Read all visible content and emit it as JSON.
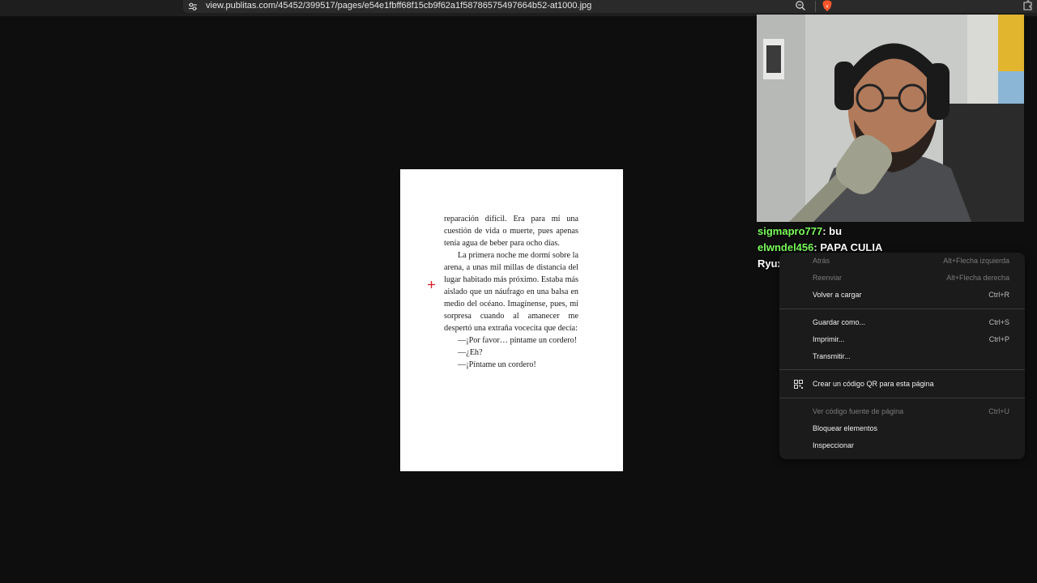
{
  "browser": {
    "url": "view.publitas.com/45452/399517/pages/e54e1fbff68f15cb9f62a1f58786575497664b52-at1000.jpg"
  },
  "page": {
    "paragraphs": [
      "reparación difícil. Era para mí una cuestión de vida o muerte, pues apenas tenía agua de beber para ocho días.",
      "La primera noche me dormí sobre la arena, a unas mil millas de distancia del lugar habitado más próximo. Estaba más aislado que un náufrago en una balsa en medio del océano. Imagínense, pues, mi sorpresa cuando al amanecer me despertó una extraña vocecita que decía:",
      "—¡Por favor… píntame un cordero!",
      "—¿Eh?",
      "—¡Píntame un cordero!"
    ]
  },
  "chat": [
    {
      "user": "sigmapro777",
      "message": "bu"
    },
    {
      "user": "elwndel456",
      "message": "PAPA CULIA"
    },
    {
      "user": "RyuxT",
      "message": ""
    }
  ],
  "context_menu": {
    "items": [
      {
        "label": "Atrás",
        "shortcut": "Alt+Flecha izquierda",
        "disabled": true
      },
      {
        "label": "Reenviar",
        "shortcut": "Alt+Flecha derecha",
        "disabled": true
      },
      {
        "label": "Volver a cargar",
        "shortcut": "Ctrl+R",
        "disabled": false
      },
      {
        "label": "Guardar como...",
        "shortcut": "Ctrl+S",
        "disabled": false
      },
      {
        "label": "Imprimir...",
        "shortcut": "Ctrl+P",
        "disabled": false
      },
      {
        "label": "Transmitir...",
        "shortcut": "",
        "disabled": false
      },
      {
        "label": "Crear un código QR para esta página",
        "shortcut": "",
        "disabled": false
      },
      {
        "label": "Ver código fuente de página",
        "shortcut": "Ctrl+U",
        "disabled": true
      },
      {
        "label": "Bloquear elementos",
        "shortcut": "",
        "disabled": false
      },
      {
        "label": "Inspeccionar",
        "shortcut": "",
        "disabled": false
      }
    ]
  },
  "colors": {
    "background": "#0e0e0e",
    "chat_username": "#7cff5c",
    "menu_bg": "#1b1b1b",
    "brave_orange": "#fb542b"
  }
}
